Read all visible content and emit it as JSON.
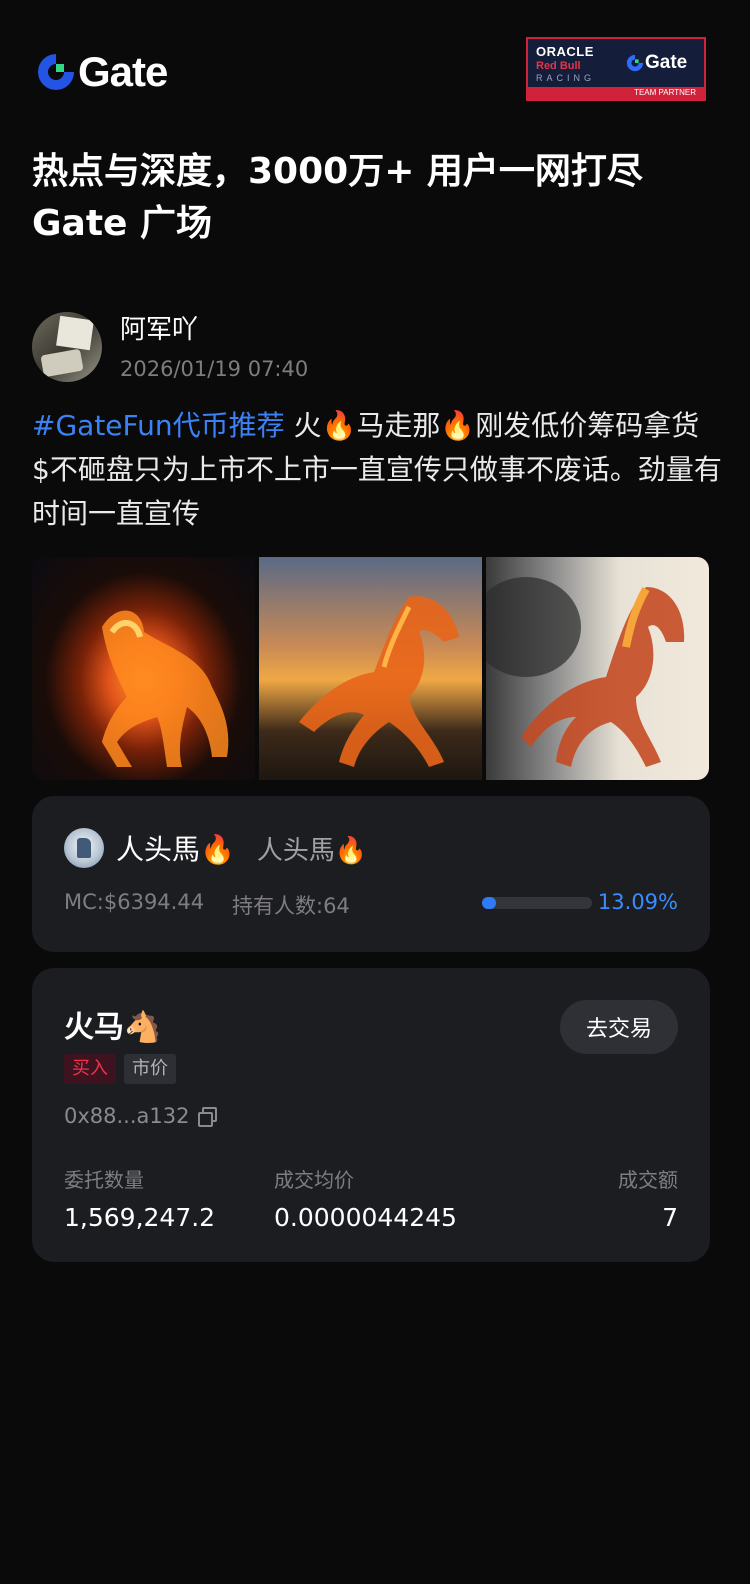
{
  "header": {
    "logo_text": "Gate",
    "partner": {
      "oracle": "ORACLE",
      "redbull": "Red Bull",
      "racing": "RACING",
      "gate": "Gate",
      "team": "TEAM PARTNER"
    }
  },
  "headline": {
    "line1": "热点与深度，3000万+ 用户一网打尽",
    "line2": "Gate 广场"
  },
  "post": {
    "author": "阿军吖",
    "time": "2026/01/19 07:40",
    "hashtag": "#GateFun代币推荐",
    "body": " 火🔥马走那🔥刚发低价筹码拿货$不砸盘只为上市不上市一直宣传只做事不废话。劲量有时间一直宣传",
    "images": [
      "fire-horse-night",
      "fire-horse-sunset",
      "fire-horse-ink"
    ]
  },
  "token": {
    "name": "人头馬🔥",
    "symbol": "人头馬🔥",
    "mc": "MC:$6394.44",
    "holders": "持有人数:64",
    "progress_pct": 13.09,
    "progress_label": "13.09%",
    "accent": "#2f7bf6"
  },
  "trade": {
    "title": "火马🐴",
    "button": "去交易",
    "side": "买入",
    "order_type": "市价",
    "address": "0x88...a132",
    "stats": [
      {
        "label": "委托数量",
        "value": "1,569,247.2"
      },
      {
        "label": "成交均价",
        "value": "0.0000044245"
      },
      {
        "label": "成交额",
        "value": "7"
      }
    ]
  }
}
